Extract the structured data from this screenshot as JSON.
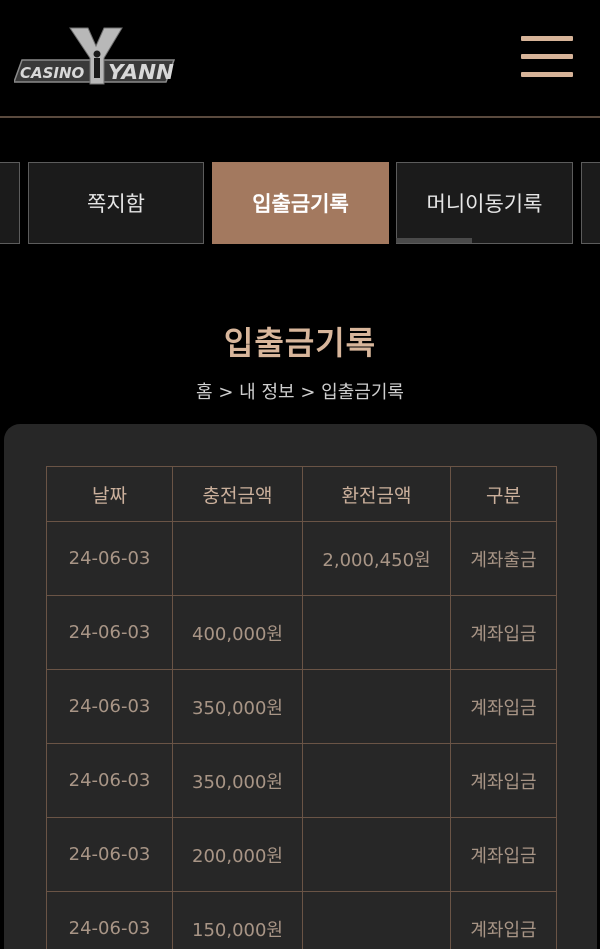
{
  "brand": {
    "logo_small": "CASINO",
    "logo_large": "YANN"
  },
  "tabs": [
    {
      "label": "쪽지함",
      "active": false
    },
    {
      "label": "입출금기록",
      "active": true
    },
    {
      "label": "머니이동기록",
      "active": false
    }
  ],
  "title": "입출금기록",
  "breadcrumb": {
    "home": "홈",
    "sep1": ">",
    "my_info": "내 정보",
    "sep2": ">",
    "current": "입출금기록"
  },
  "table": {
    "headers": [
      "날짜",
      "충전금액",
      "환전금액",
      "구분"
    ],
    "rows": [
      {
        "date": "24-06-03",
        "deposit": "",
        "withdraw": "2,000,450원",
        "type": "계좌출금"
      },
      {
        "date": "24-06-03",
        "deposit": "400,000원",
        "withdraw": "",
        "type": "계좌입금"
      },
      {
        "date": "24-06-03",
        "deposit": "350,000원",
        "withdraw": "",
        "type": "계좌입금"
      },
      {
        "date": "24-06-03",
        "deposit": "350,000원",
        "withdraw": "",
        "type": "계좌입금"
      },
      {
        "date": "24-06-03",
        "deposit": "200,000원",
        "withdraw": "",
        "type": "계좌입금"
      },
      {
        "date": "24-06-03",
        "deposit": "150,000원",
        "withdraw": "",
        "type": "계좌입금"
      }
    ]
  },
  "colors": {
    "accent": "#a3795f",
    "title": "#d8b69b",
    "table_border": "#6a5446",
    "panel": "#272727"
  },
  "icons": {
    "menu": "hamburger-menu-icon",
    "logo": "casino-yann-logo"
  }
}
